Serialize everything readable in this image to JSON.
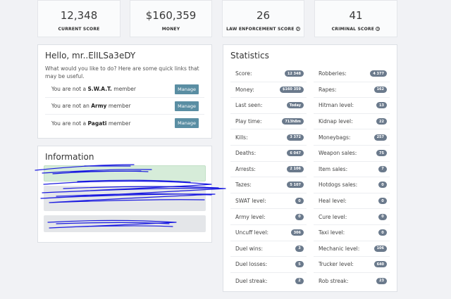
{
  "top_stats": [
    {
      "value": "12,348",
      "label": "CURRENT SCORE",
      "help": false
    },
    {
      "value": "$160,359",
      "label": "MONEY",
      "help": false
    },
    {
      "value": "26",
      "label": "LAW ENFORCEMENT SCORE",
      "help": true
    },
    {
      "value": "41",
      "label": "CRIMINAL SCORE",
      "help": true
    }
  ],
  "help_glyph": "?",
  "welcome": {
    "title": "Hello, mr..ElILSa3eDY",
    "subtitle": "What would you like to do? Here are some quick links that may be useful.",
    "memberships": [
      {
        "prefix": "You are not a ",
        "group": "S.W.A.T.",
        "suffix": " member",
        "button": "Manage"
      },
      {
        "prefix": "You are not an ",
        "group": "Army",
        "suffix": " member",
        "button": "Manage"
      },
      {
        "prefix": "You are not a ",
        "group": "Pagati",
        "suffix": " member",
        "button": "Manage"
      }
    ]
  },
  "information": {
    "title": "Information"
  },
  "statistics": {
    "title": "Statistics",
    "left": [
      {
        "label": "Score:",
        "value": "12 348"
      },
      {
        "label": "Money:",
        "value": "$160 359"
      },
      {
        "label": "Last seen:",
        "value": "Today"
      },
      {
        "label": "Play time:",
        "value": "713h8m"
      },
      {
        "label": "Kills:",
        "value": "3 372"
      },
      {
        "label": "Deaths:",
        "value": "6 047"
      },
      {
        "label": "Arrests:",
        "value": "2 106"
      },
      {
        "label": "Tazes:",
        "value": "5 107"
      },
      {
        "label": "SWAT level:",
        "value": "0"
      },
      {
        "label": "Army level:",
        "value": "0"
      },
      {
        "label": "Uncuff level:",
        "value": "306"
      },
      {
        "label": "Duel wins:",
        "value": "3"
      },
      {
        "label": "Duel losses:",
        "value": "5"
      },
      {
        "label": "Duel streak:",
        "value": "2"
      }
    ],
    "right": [
      {
        "label": "Robberies:",
        "value": "4 377"
      },
      {
        "label": "Rapes:",
        "value": "162"
      },
      {
        "label": "Hitman level:",
        "value": "13"
      },
      {
        "label": "Kidnap level:",
        "value": "22"
      },
      {
        "label": "Moneybags:",
        "value": "257"
      },
      {
        "label": "Weapon sales:",
        "value": "75"
      },
      {
        "label": "Item sales:",
        "value": "7"
      },
      {
        "label": "Hotdogs sales:",
        "value": "0"
      },
      {
        "label": "Heal level:",
        "value": "0"
      },
      {
        "label": "Cure level:",
        "value": "0"
      },
      {
        "label": "Taxi level:",
        "value": "0"
      },
      {
        "label": "Mechanic level:",
        "value": "106"
      },
      {
        "label": "Trucker level:",
        "value": "640"
      },
      {
        "label": "Rob streak:",
        "value": "23"
      }
    ]
  },
  "colors": {
    "manage_button": "#5a8ea3",
    "badge": "#6b7a8c",
    "scribble": "#1a1ae0"
  }
}
